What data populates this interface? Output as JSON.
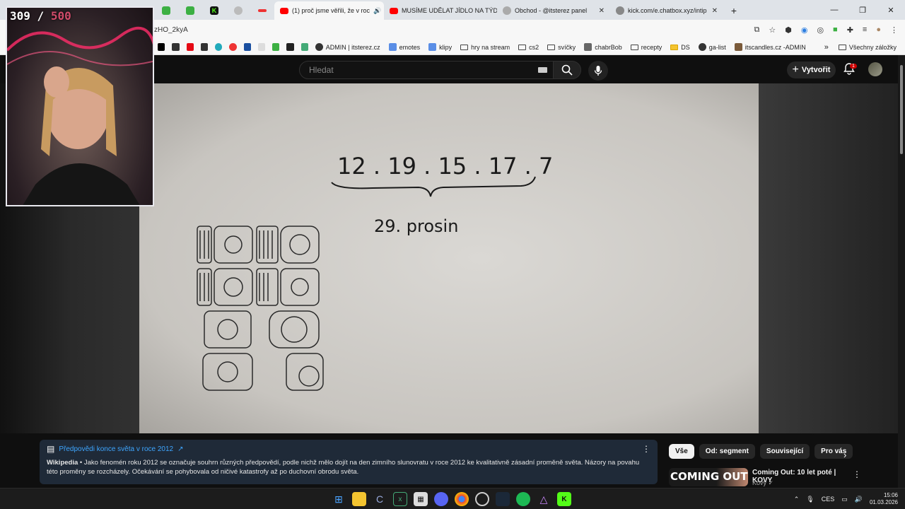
{
  "overlay": {
    "counter_current": "309",
    "counter_sep": "/",
    "counter_max": "500"
  },
  "browser": {
    "tabs": [
      {
        "title": "(1) proč jsme věřili, že v roc",
        "fav": "#ff0000"
      },
      {
        "title": "MUSÍME UDĚLAT JÍDLO NA TÝD",
        "fav": "#ff0000"
      },
      {
        "title": "Obchod - @itsterez panel",
        "fav": "#999999"
      },
      {
        "title": "kick.com/e.chatbox.xyz/intip",
        "fav": "#888888"
      }
    ],
    "url": "zHO_2kyA",
    "bookmarks": [
      {
        "label": "ADMIN | itsterez.cz"
      },
      {
        "label": "emotes"
      },
      {
        "label": "klipy"
      },
      {
        "label": "hry na stream"
      },
      {
        "label": "cs2"
      },
      {
        "label": "svíčky"
      },
      {
        "label": "chabrBob"
      },
      {
        "label": "recepty"
      },
      {
        "label": "DS"
      },
      {
        "label": "ga-list"
      },
      {
        "label": "itscandles.cz -ADMIN"
      }
    ],
    "all_bookmarks": "Všechny záložky"
  },
  "youtube": {
    "search_placeholder": "Hledat",
    "create_label": "Vytvořit",
    "notif_count": "1"
  },
  "video": {
    "date_numbers": "12 . 19 . 15 . 17 . 7",
    "date_label": "29. prosin"
  },
  "info_panel": {
    "title": "Předpovědi konce světa v roce 2012",
    "source": "Wikipedia",
    "text": " • Jako fenomén roku 2012 se označuje souhrn různých předpovědí, podle nichž mělo dojít na den zimního slunovratu v roce 2012 ke kvalitativně zásadní proměně světa. Názory na povahu této proměny se rozcházely. Očekávání se pohybovala od ničivé katastrofy až po duchovní obrodu světa."
  },
  "chips": [
    "Vše",
    "Od: segment",
    "Související",
    "Pro vás"
  ],
  "recommended": {
    "thumb_text": "COMING OUT",
    "title": "Coming Out: 10 let poté | KOVY",
    "channel": "Kovy"
  },
  "taskbar": {
    "lang": "CES",
    "time": "15:06",
    "date": "01.03.2026"
  }
}
